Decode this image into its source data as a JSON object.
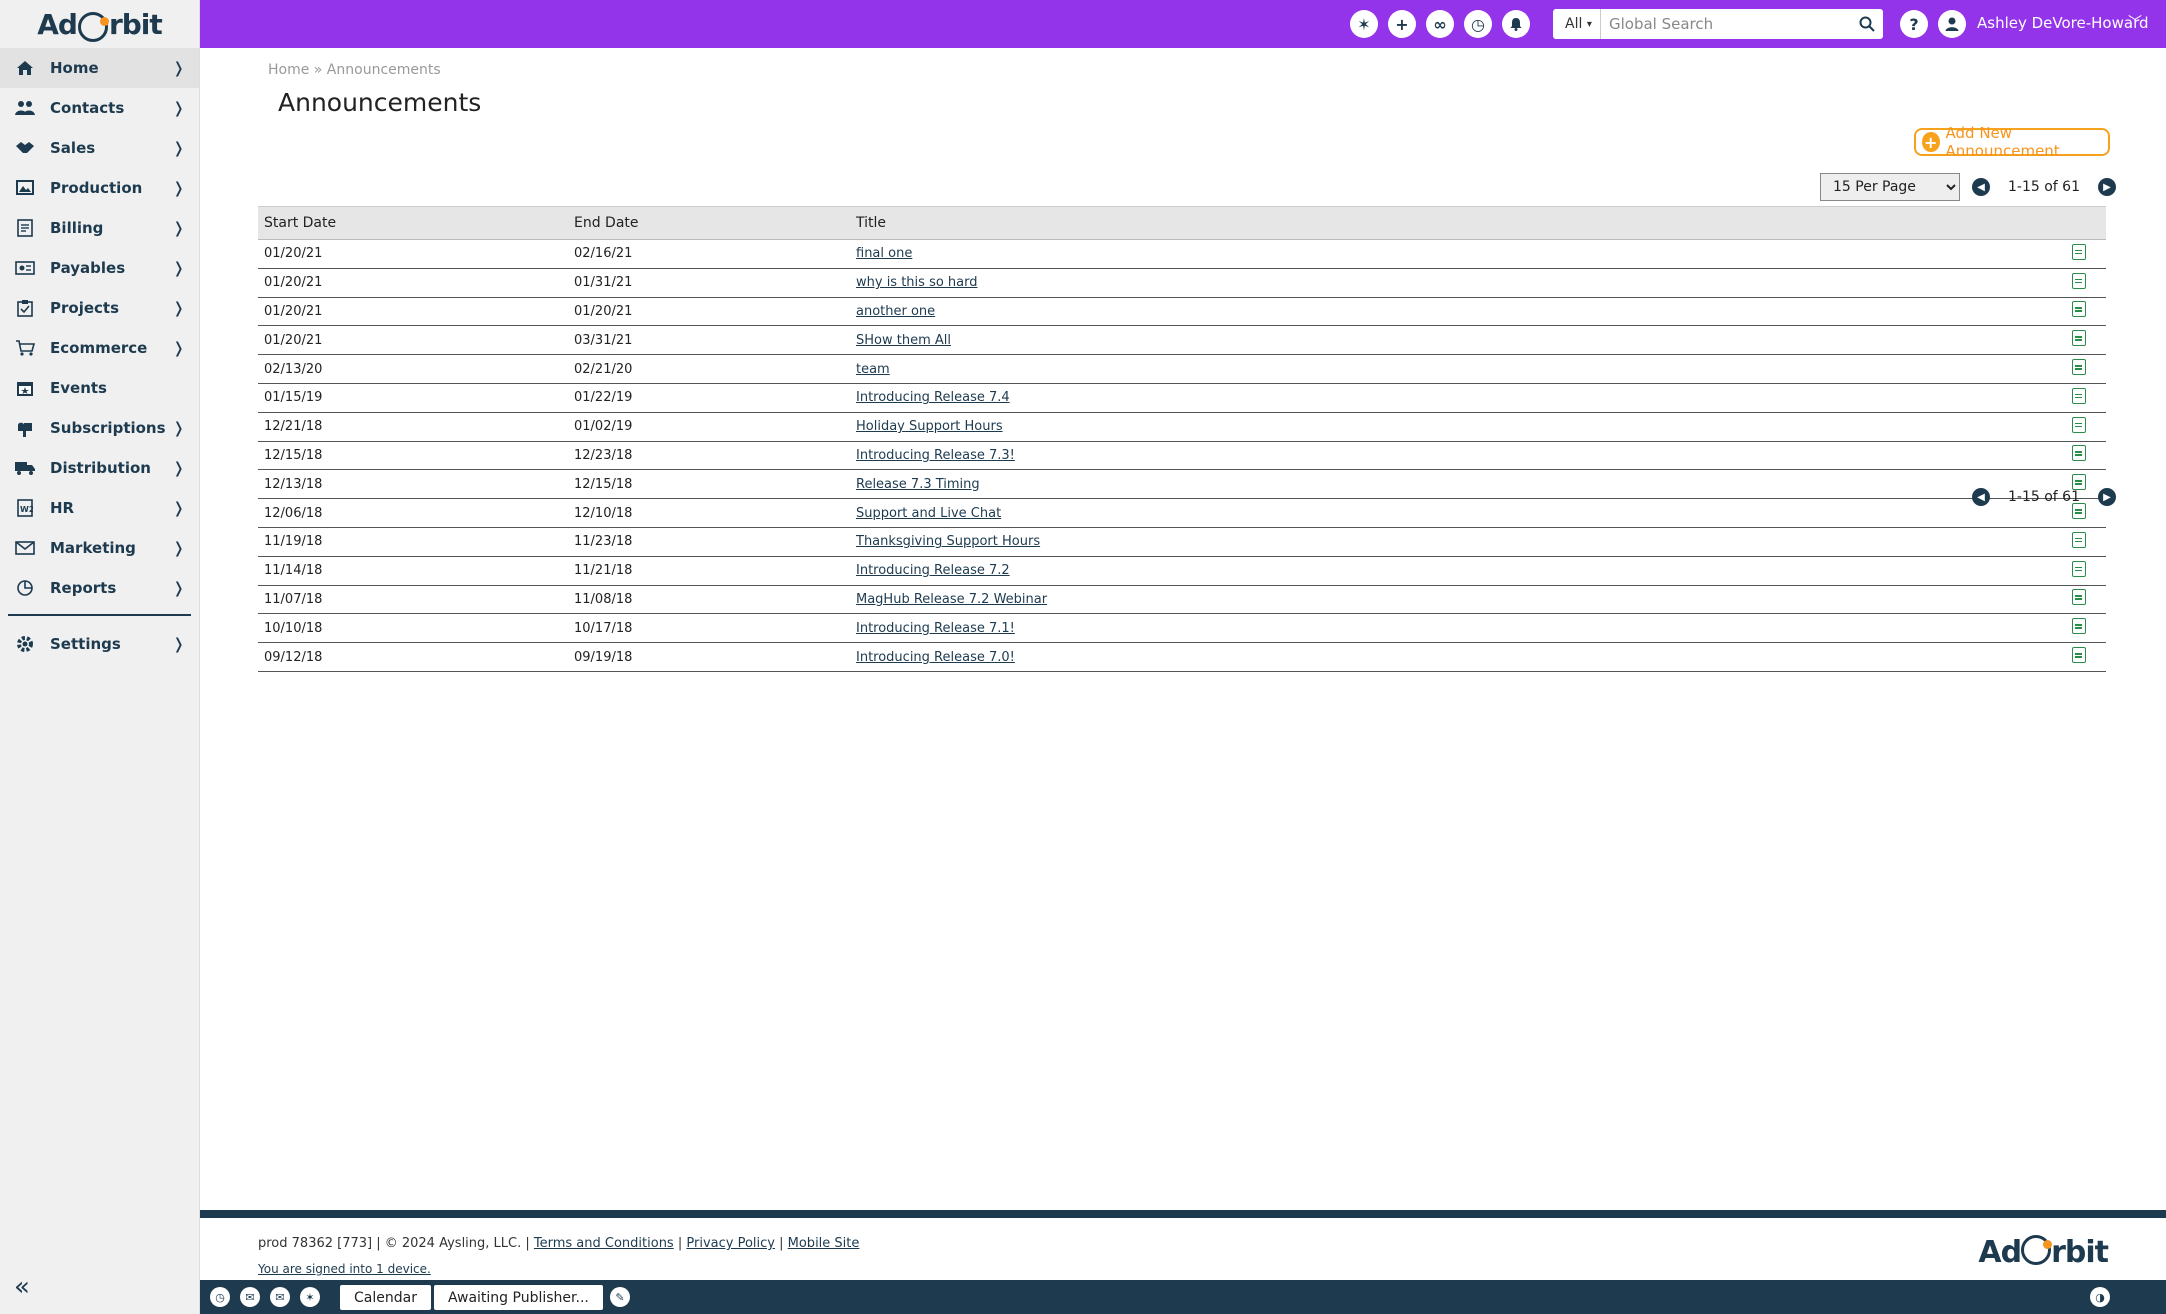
{
  "app": {
    "brand": "AdOrbit"
  },
  "sidebar": {
    "items": [
      {
        "label": "Home",
        "icon": "home-icon",
        "has_submenu": true,
        "active": true
      },
      {
        "label": "Contacts",
        "icon": "contacts-icon",
        "has_submenu": true
      },
      {
        "label": "Sales",
        "icon": "handshake-icon",
        "has_submenu": true
      },
      {
        "label": "Production",
        "icon": "production-icon",
        "has_submenu": true
      },
      {
        "label": "Billing",
        "icon": "billing-icon",
        "has_submenu": true
      },
      {
        "label": "Payables",
        "icon": "payables-icon",
        "has_submenu": true
      },
      {
        "label": "Projects",
        "icon": "clipboard-icon",
        "has_submenu": true
      },
      {
        "label": "Ecommerce",
        "icon": "cart-icon",
        "has_submenu": true
      },
      {
        "label": "Events",
        "icon": "calendar-star-icon",
        "has_submenu": false
      },
      {
        "label": "Subscriptions",
        "icon": "mailbox-icon",
        "has_submenu": true
      },
      {
        "label": "Distribution",
        "icon": "truck-icon",
        "has_submenu": true
      },
      {
        "label": "HR",
        "icon": "w2-form-icon",
        "has_submenu": true
      },
      {
        "label": "Marketing",
        "icon": "envelope-icon",
        "has_submenu": true
      },
      {
        "label": "Reports",
        "icon": "reports-icon",
        "has_submenu": true
      }
    ],
    "settings": {
      "label": "Settings",
      "icon": "gear-icon"
    }
  },
  "topbar": {
    "search_scope": "All",
    "search_placeholder": "Global Search",
    "user_name": "Ashley DeVore-Howard",
    "color": "#9333ea"
  },
  "main": {
    "breadcrumb": "Home » Announcements",
    "title": "Announcements",
    "add_button_label": "Add New Announcement",
    "per_page_label": "15 Per Page",
    "pager_text": "1-15 of 61",
    "columns": [
      "Start Date",
      "End Date",
      "Title"
    ],
    "rows": [
      {
        "start": "01/20/21",
        "end": "02/16/21",
        "title": "final one"
      },
      {
        "start": "01/20/21",
        "end": "01/31/21",
        "title": "why is this so hard"
      },
      {
        "start": "01/20/21",
        "end": "01/20/21",
        "title": "another one"
      },
      {
        "start": "01/20/21",
        "end": "03/31/21",
        "title": "SHow them All"
      },
      {
        "start": "02/13/20",
        "end": "02/21/20",
        "title": "team"
      },
      {
        "start": "01/15/19",
        "end": "01/22/19",
        "title": "Introducing Release 7.4"
      },
      {
        "start": "12/21/18",
        "end": "01/02/19",
        "title": "Holiday Support Hours"
      },
      {
        "start": "12/15/18",
        "end": "12/23/18",
        "title": "Introducing Release 7.3!"
      },
      {
        "start": "12/13/18",
        "end": "12/15/18",
        "title": "Release 7.3 Timing"
      },
      {
        "start": "12/06/18",
        "end": "12/10/18",
        "title": "Support and Live Chat"
      },
      {
        "start": "11/19/18",
        "end": "11/23/18",
        "title": "Thanksgiving Support Hours"
      },
      {
        "start": "11/14/18",
        "end": "11/21/18",
        "title": "Introducing Release 7.2"
      },
      {
        "start": "11/07/18",
        "end": "11/08/18",
        "title": "MagHub Release 7.2 Webinar"
      },
      {
        "start": "10/10/18",
        "end": "10/17/18",
        "title": "Introducing Release 7.1!"
      },
      {
        "start": "09/12/18",
        "end": "09/19/18",
        "title": "Introducing Release 7.0!"
      }
    ]
  },
  "footer": {
    "prefix": "prod 78362 [773] | © 2024 Aysling, LLC. |",
    "terms": "Terms and Conditions",
    "privacy": "Privacy Policy",
    "mobile": "Mobile Site",
    "signed_in": "You are signed into 1 device."
  },
  "bottombar": {
    "tabs": [
      "Calendar",
      "Awaiting Publisher..."
    ]
  }
}
